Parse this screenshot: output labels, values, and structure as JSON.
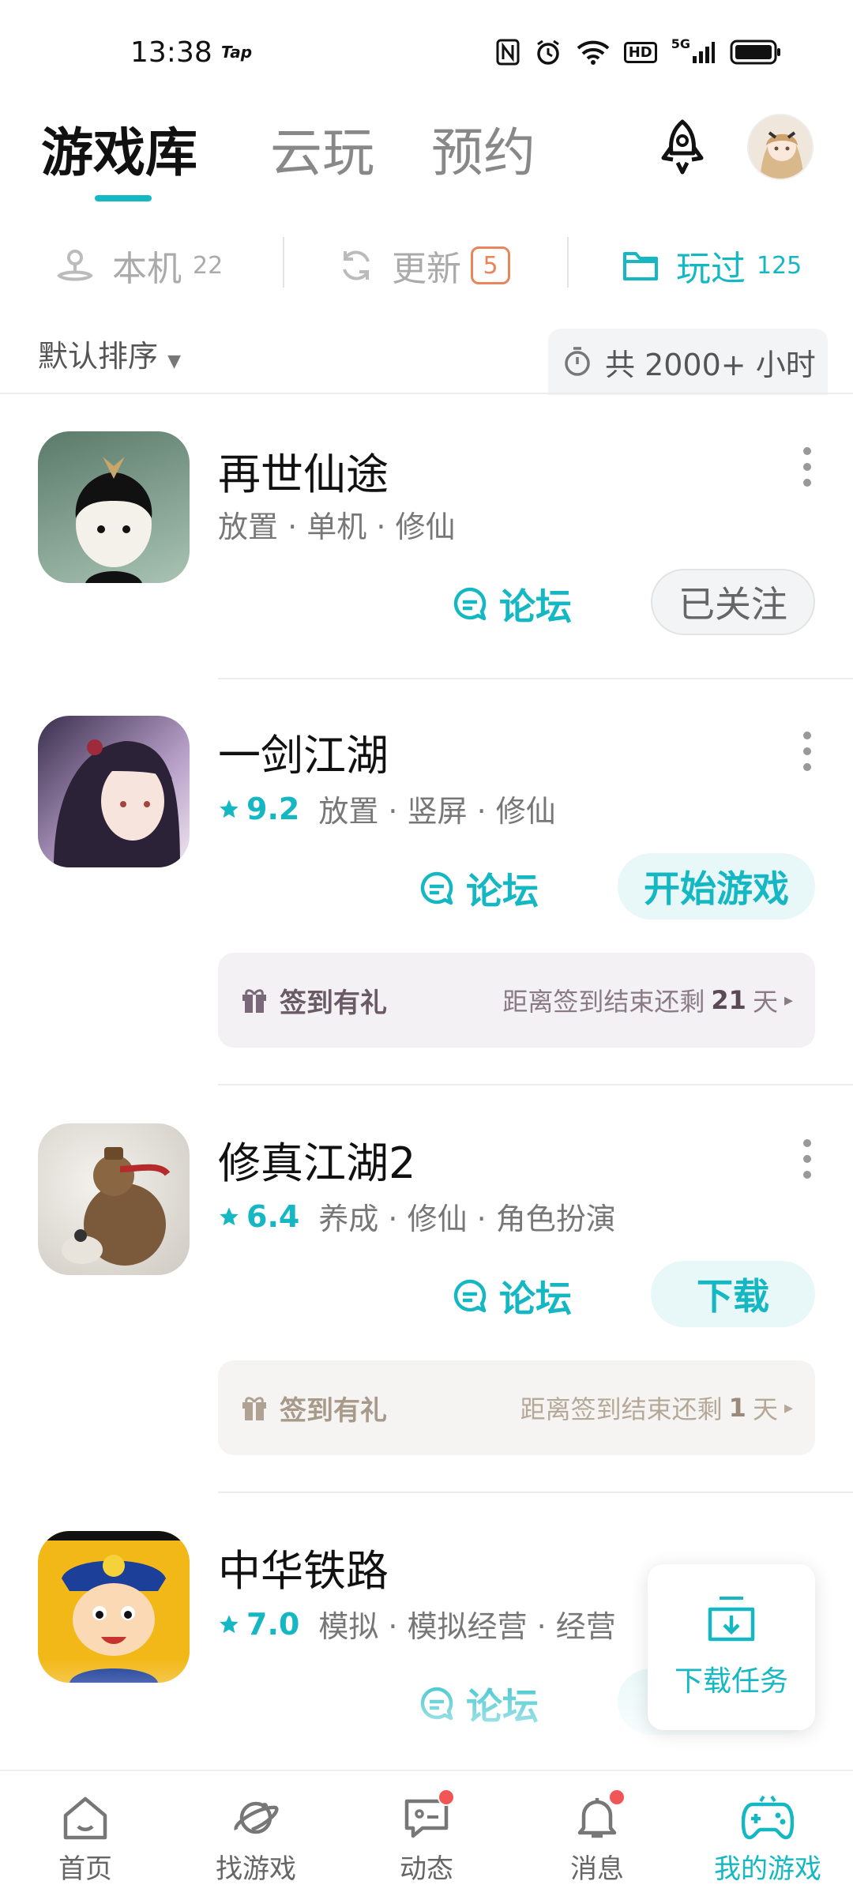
{
  "status_bar": {
    "time": "13:38",
    "app_badge": "Tap",
    "network": "5G",
    "hd": "HD"
  },
  "header": {
    "tabs": [
      {
        "label": "游戏库",
        "active": true
      },
      {
        "label": "云玩",
        "active": false
      },
      {
        "label": "预约",
        "active": false
      }
    ],
    "accent": "#15b8c2"
  },
  "filters": {
    "local": {
      "label": "本机",
      "count": "22"
    },
    "update": {
      "label": "更新",
      "count": "5"
    },
    "played": {
      "label": "玩过",
      "count": "125"
    }
  },
  "sort": {
    "label": "默认排序"
  },
  "total_hours": {
    "label": "共 2000+ 小时"
  },
  "games": [
    {
      "name": "再世仙途",
      "rating": "",
      "tags": "放置 · 单机 · 修仙",
      "forum": "论坛",
      "action": "已关注"
    },
    {
      "name": "一剑江湖",
      "rating": "9.2",
      "tags": "放置 · 竖屏 · 修仙",
      "forum": "论坛",
      "action": "开始游戏",
      "signin": {
        "label": "签到有礼",
        "prefix": "距离签到结束还剩",
        "days": "21",
        "unit": "天"
      }
    },
    {
      "name": "修真江湖2",
      "rating": "6.4",
      "tags": "养成 · 修仙 · 角色扮演",
      "forum": "论坛",
      "action": "下载",
      "signin": {
        "label": "签到有礼",
        "prefix": "距离签到结束还剩",
        "days": "1",
        "unit": "天"
      }
    },
    {
      "name": "中华铁路",
      "rating": "7.0",
      "tags": "模拟 · 模拟经营 · 经营",
      "forum": "论坛",
      "action": ""
    }
  ],
  "download_tasks": {
    "label": "下载任务"
  },
  "bottom_nav": [
    {
      "label": "首页",
      "icon": "home-icon",
      "dot": false,
      "active": false
    },
    {
      "label": "找游戏",
      "icon": "planet-icon",
      "dot": false,
      "active": false
    },
    {
      "label": "动态",
      "icon": "chat-icon",
      "dot": true,
      "active": false
    },
    {
      "label": "消息",
      "icon": "bell-icon",
      "dot": true,
      "active": false
    },
    {
      "label": "我的游戏",
      "icon": "gamepad-icon",
      "dot": false,
      "active": true
    }
  ]
}
